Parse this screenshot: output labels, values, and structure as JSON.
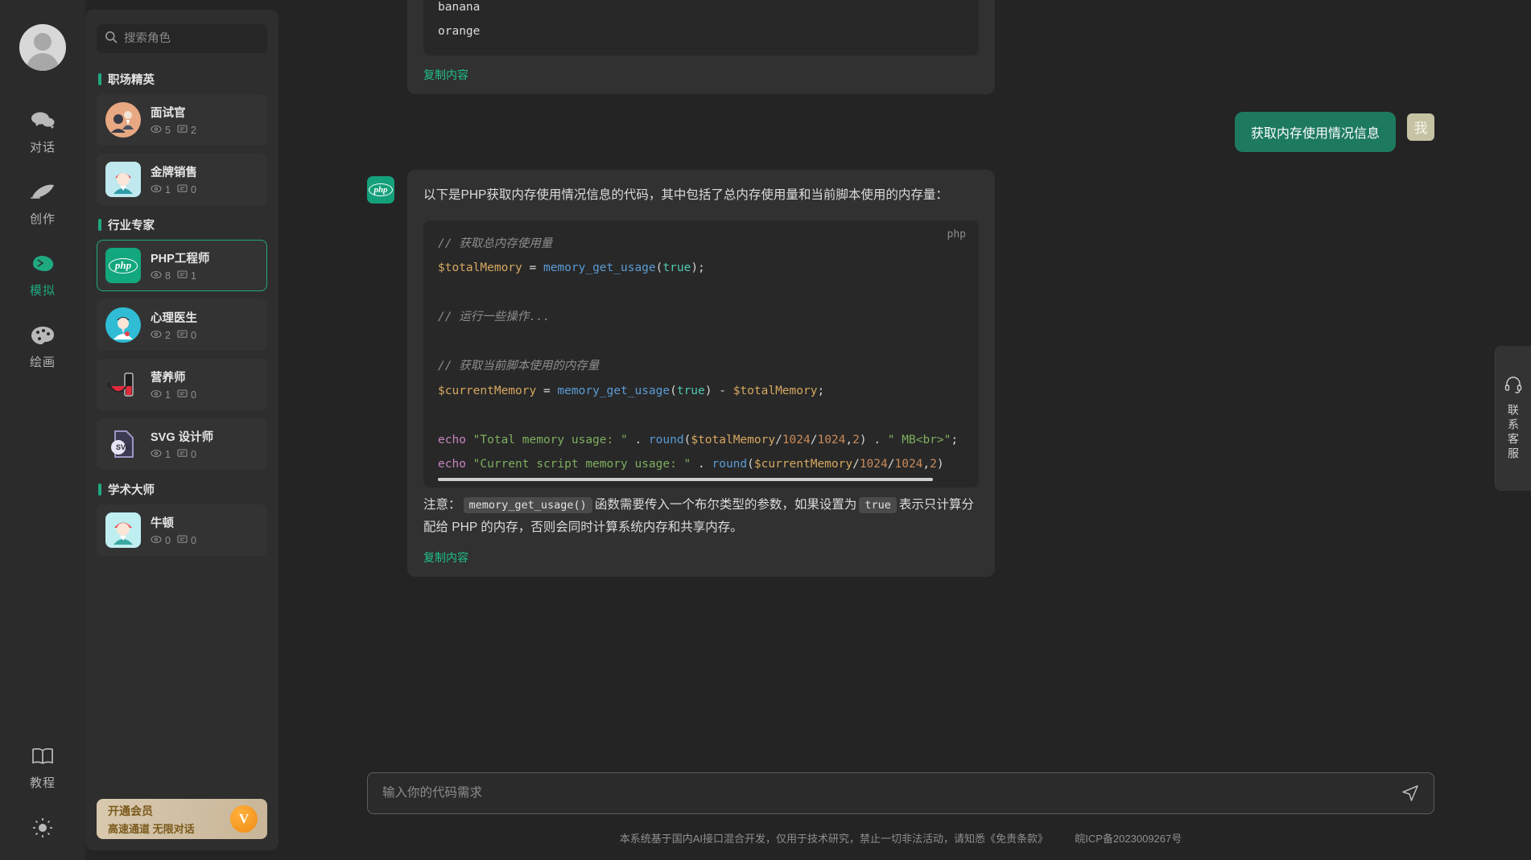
{
  "rail": {
    "avatar_name": "user-avatar",
    "items": [
      {
        "icon": "chat-bubbles-icon",
        "label": "对话",
        "active": false
      },
      {
        "icon": "feather-pen-icon",
        "label": "创作",
        "active": false
      },
      {
        "icon": "brain-icon",
        "label": "模拟",
        "active": true
      },
      {
        "icon": "palette-icon",
        "label": "绘画",
        "active": false
      }
    ],
    "bottom_items": [
      {
        "icon": "book-icon",
        "label": "教程"
      },
      {
        "icon": "sun-icon",
        "label": ""
      }
    ],
    "active_color": "#1fa97f"
  },
  "sidebar": {
    "search": {
      "placeholder": "搜索角色",
      "value": "",
      "icon": "search-icon"
    },
    "sections": [
      {
        "title": "职场精英",
        "roles": [
          {
            "name": "面试官",
            "views": "5",
            "comments": "2",
            "selected": false
          },
          {
            "name": "金牌销售",
            "views": "1",
            "comments": "0",
            "selected": false
          }
        ]
      },
      {
        "title": "行业专家",
        "roles": [
          {
            "name": "PHP工程师",
            "views": "8",
            "comments": "1",
            "selected": true
          },
          {
            "name": "心理医生",
            "views": "2",
            "comments": "0",
            "selected": false
          },
          {
            "name": "营养师",
            "views": "1",
            "comments": "0",
            "selected": false
          },
          {
            "name": "SVG 设计师",
            "views": "1",
            "comments": "0",
            "selected": false
          }
        ]
      },
      {
        "title": "学术大师",
        "roles": [
          {
            "name": "牛顿",
            "views": "0",
            "comments": "0",
            "selected": false
          }
        ]
      }
    ],
    "vip": {
      "title": "开通会员",
      "subtitle": "高速通道 无限对话",
      "badge_letter": "V"
    }
  },
  "chat": {
    "previous_message": {
      "code_lines": [
        "banana",
        "orange"
      ],
      "copy_label": "复制内容"
    },
    "user_message": {
      "text": "获取内存使用情况信息",
      "avatar_label": "我"
    },
    "bot_message": {
      "avatar_label": "php",
      "intro": "以下是PHP获取内存使用情况信息的代码，其中包括了总内存使用量和当前脚本使用的内存量：",
      "code_lang": "php",
      "code": {
        "lines": [
          "// 获取总内存使用量",
          "$totalMemory = memory_get_usage(true);",
          "",
          "// 运行一些操作...",
          "",
          "// 获取当前脚本使用的内存量",
          "$currentMemory = memory_get_usage(true) - $totalMemory;",
          "",
          "echo \"Total memory usage: \" . round($totalMemory/1024/1024,2) . \" MB<br>\";",
          "echo \"Current script memory usage: \" . round($currentMemory/1024/1024,2) . \" MB<br>\";"
        ]
      },
      "note_prefix": "注意：",
      "note_code_1": "memory_get_usage()",
      "note_mid": "函数需要传入一个布尔类型的参数，如果设置为",
      "note_code_2": "true",
      "note_suffix": "表示只计算分配给 PHP 的内存，否则会同时计算系统内存和共享内存。",
      "copy_label": "复制内容"
    }
  },
  "composer": {
    "placeholder": "输入你的代码需求",
    "value": "",
    "send_icon": "send-icon"
  },
  "footer": {
    "text": "本系统基于国内AI接口混合开发，仅用于技术研究，禁止一切非法活动，请知悉《免责条款》",
    "icp": "皖ICP备2023009267号"
  },
  "support": {
    "label": "联系客服",
    "icon": "headset-icon"
  },
  "colors": {
    "accent": "#1fa97f",
    "user_bubble": "#1d7a5f",
    "bot_bubble": "#313131",
    "page_bg": "#242424",
    "panel_bg": "#2e2e2e"
  }
}
